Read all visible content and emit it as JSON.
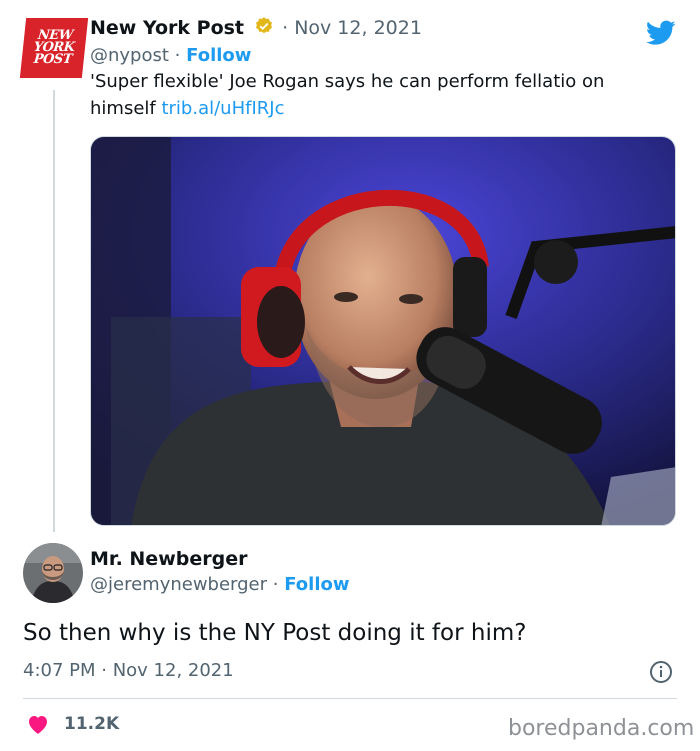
{
  "tweet1": {
    "logo_lines": [
      "NEW",
      "YORK",
      "POST"
    ],
    "display_name": "New York Post",
    "date": "· Nov 12, 2021",
    "handle": "@nypost",
    "sep": "·",
    "follow": "Follow",
    "text": "'Super flexible' Joe Rogan says he can perform fellatio on himself",
    "link": "trib.al/uHfIRJc"
  },
  "tweet2": {
    "display_name": "Mr. Newberger",
    "handle": "@jeremynewberger",
    "sep": "·",
    "follow": "Follow",
    "text": "So then why is the NY Post doing it for him?",
    "timestamp": "4:07 PM · Nov 12, 2021",
    "likes": "11.2K"
  },
  "watermark": "boredpanda.com",
  "colors": {
    "accent": "#1d9bf0",
    "logo_red": "#d8232a",
    "heart": "#f91880"
  }
}
